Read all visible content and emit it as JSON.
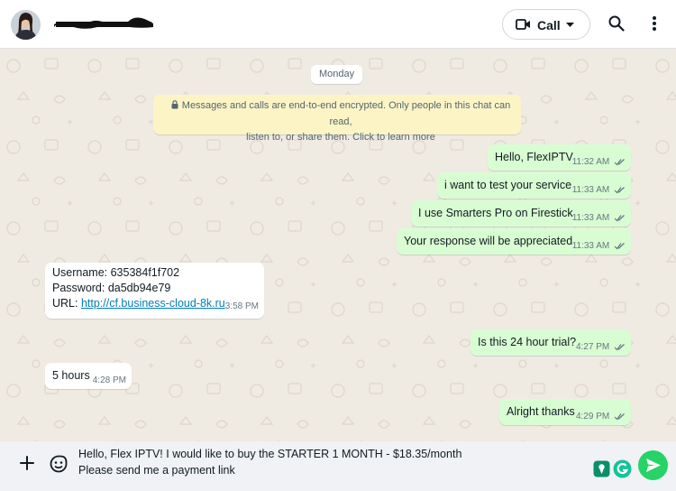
{
  "header": {
    "call_label": "Call"
  },
  "chat": {
    "day_label": "Monday",
    "encryption_notice": {
      "line1": "Messages and calls are end-to-end encrypted. Only people in this chat can read,",
      "line2": "listen to, or share them. Click to learn more"
    },
    "messages": [
      {
        "direction": "out",
        "text": "Hello, FlexIPTV",
        "time": "11:32 AM",
        "status": "read"
      },
      {
        "direction": "out",
        "text": "i want to test your service",
        "time": "11:33 AM",
        "status": "read"
      },
      {
        "direction": "out",
        "text": "I use Smarters Pro on Firestick",
        "time": "11:33 AM",
        "status": "read"
      },
      {
        "direction": "out",
        "text": "Your response will be appreciated",
        "time": "11:33 AM",
        "status": "read"
      },
      {
        "direction": "in",
        "lines": [
          "Username: 635384f1f702",
          "Password: da5db94e79"
        ],
        "url_prefix": "URL: ",
        "url": "http://cf.business-cloud-8k.ru",
        "time": "3:58 PM"
      },
      {
        "direction": "out",
        "text": "Is this 24 hour trial?",
        "time": "4:27 PM",
        "status": "read"
      },
      {
        "direction": "in",
        "text": "5 hours",
        "time": "4:28 PM"
      },
      {
        "direction": "out",
        "text": "Alright thanks",
        "time": "4:29 PM",
        "status": "read"
      }
    ]
  },
  "composer": {
    "draft_line1": "Hello, Flex IPTV! I would like to buy the STARTER 1 MONTH - $18.35/month",
    "draft_line2": "Please send me a payment link"
  },
  "colors": {
    "outgoing_bubble": "#d9fdd3",
    "incoming_bubble": "#ffffff",
    "read_ticks": "#667781",
    "send_button": "#25d366",
    "link": "#027eb5"
  },
  "icons": [
    "avatar",
    "video-camera-icon",
    "chevron-down-icon",
    "search-icon",
    "more-vert-icon",
    "lock-icon",
    "double-check-icon",
    "plus-icon",
    "sticker-icon",
    "extension-icon",
    "grammarly-icon",
    "send-icon"
  ]
}
